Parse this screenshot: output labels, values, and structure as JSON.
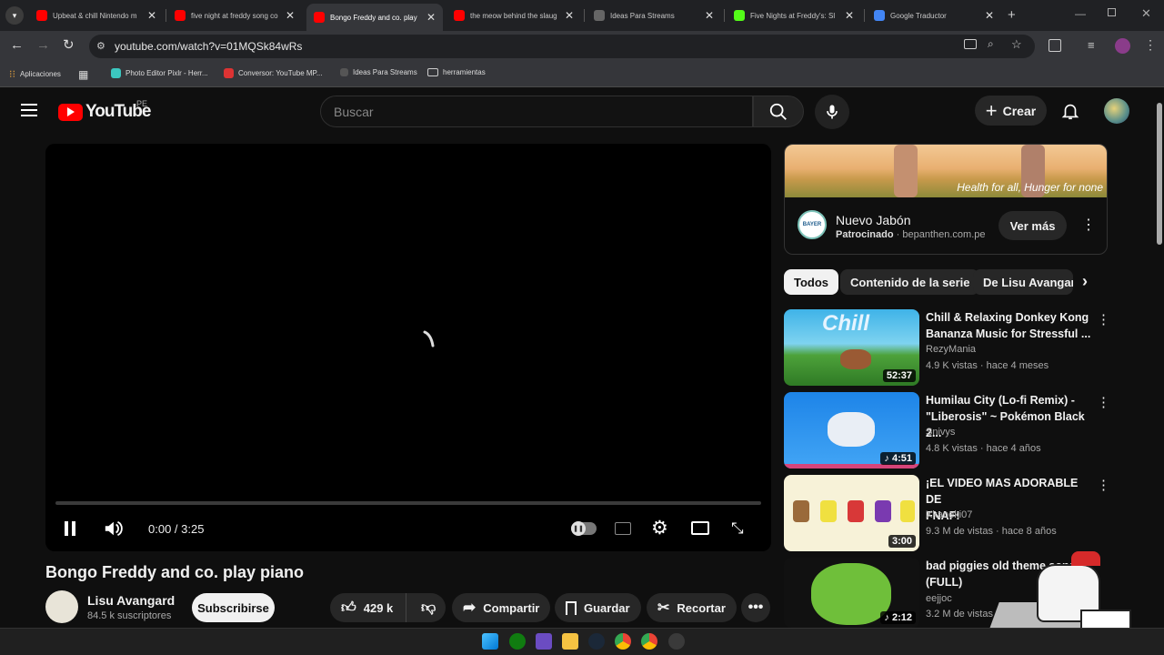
{
  "browser": {
    "tabs": [
      {
        "title": "Upbeat & chill Nintendo m",
        "active": false
      },
      {
        "title": "five night at freddy song co",
        "active": false
      },
      {
        "title": "Bongo Freddy and co. play",
        "active": true
      },
      {
        "title": "the meow behind the slaug",
        "active": false
      },
      {
        "title": "Ideas Para Streams",
        "active": false
      },
      {
        "title": "Five Nights at Freddy's: Sl",
        "active": false
      },
      {
        "title": "Google Traductor",
        "active": false
      }
    ],
    "url": "youtube.com/watch?v=01MQSk84wRs",
    "bookmarks": [
      "Aplicaciones",
      "Photo Editor Pixlr - Herr...",
      "Conversor: YouTube MP...",
      "Ideas Para Streams",
      "herramientas"
    ]
  },
  "header": {
    "logo_text": "YouTube",
    "region": "PE",
    "search_placeholder": "Buscar",
    "create_label": "Crear"
  },
  "player": {
    "time": "0:00 / 3:25",
    "progress": 0
  },
  "video": {
    "title": "Bongo Freddy and co. play piano",
    "channel": "Lisu Avangard",
    "subscribers": "84.5 k suscriptores",
    "subscribe_label": "Subscribirse",
    "likes": "429 k",
    "share_label": "Compartir",
    "save_label": "Guardar",
    "clip_label": "Recortar"
  },
  "ad": {
    "banner_text": "Health for all, Hunger for none",
    "brand_logo_text": "BAYER",
    "name": "Nuevo Jabón",
    "sponsored": "Patrocinado",
    "domain": "bepanthen.com.pe",
    "cta": "Ver más"
  },
  "chips": [
    "Todos",
    "Contenido de la serie",
    "De Lisu Avangard"
  ],
  "recommendations": [
    {
      "title_1": "Chill & Relaxing Donkey Kong",
      "title_2": "Bananza Music for Stressful ...",
      "channel": "RezyMania",
      "meta": "4.9 K vistas · hace 4 meses",
      "duration": "52:37",
      "thumb_text": "Chill"
    },
    {
      "title_1": "Humilau City (Lo-fi Remix) -",
      "title_2": "\"Liberosis\" ~ Pokémon Black 2...",
      "channel": "Snivys",
      "meta": "4.8 K vistas · hace 4 años",
      "duration": "4:51"
    },
    {
      "title_1": "¡EL VIDEO MAS ADORABLE DE",
      "title_2": "FNAF!",
      "channel": "Xkaneki07",
      "meta": "9.3 M de vistas · hace 8 años",
      "duration": "3:00"
    },
    {
      "title_1": "bad piggies old theme song",
      "title_2": "(FULL)",
      "channel": "eejjoc",
      "meta": "3.2 M de vistas",
      "duration": "2:12"
    }
  ],
  "colors": {
    "accent": "#ff0000",
    "bg": "#0f0f0f",
    "chip_active": "#f1f1f1"
  }
}
